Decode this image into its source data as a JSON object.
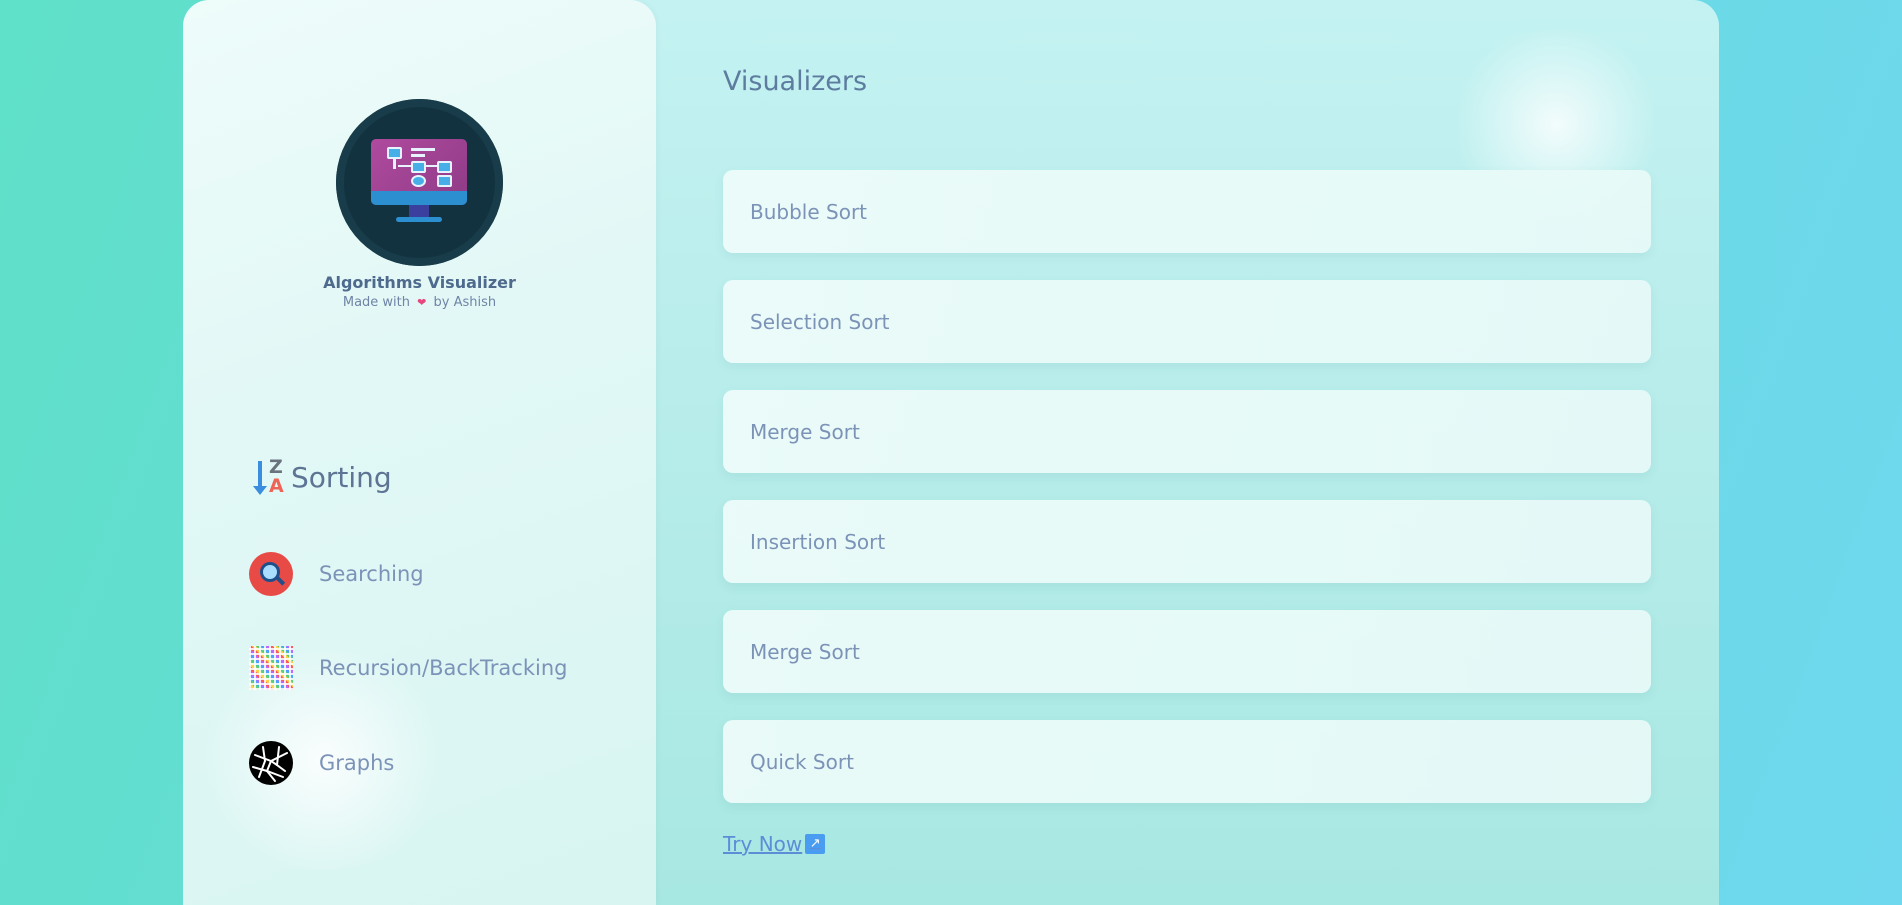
{
  "sidebar": {
    "app_title": "Algorithms Visualizer",
    "subtitle_prefix": "Made with",
    "subtitle_suffix": "by Ashish",
    "nav": {
      "sorting": "Sorting",
      "searching": "Searching",
      "recursion": "Recursion/BackTracking",
      "graphs": "Graphs"
    }
  },
  "main": {
    "title": "Visualizers",
    "cards": [
      "Bubble Sort",
      "Selection Sort",
      "Merge Sort",
      "Insertion Sort",
      "Merge Sort",
      "Quick Sort"
    ],
    "try_now": "Try Now"
  },
  "icons": {
    "logo": "monitor-flowchart-icon",
    "sorting": "sort-z-a-icon",
    "searching": "magnifier-icon",
    "recursion": "checker-pattern-icon",
    "graphs": "graph-ball-icon",
    "heart": "heart-icon",
    "external": "external-link-icon"
  },
  "colors": {
    "accent_text": "#7c93b8",
    "title_text": "#5d7c9f",
    "link": "#5b8ed6",
    "heart": "#e8467c"
  }
}
